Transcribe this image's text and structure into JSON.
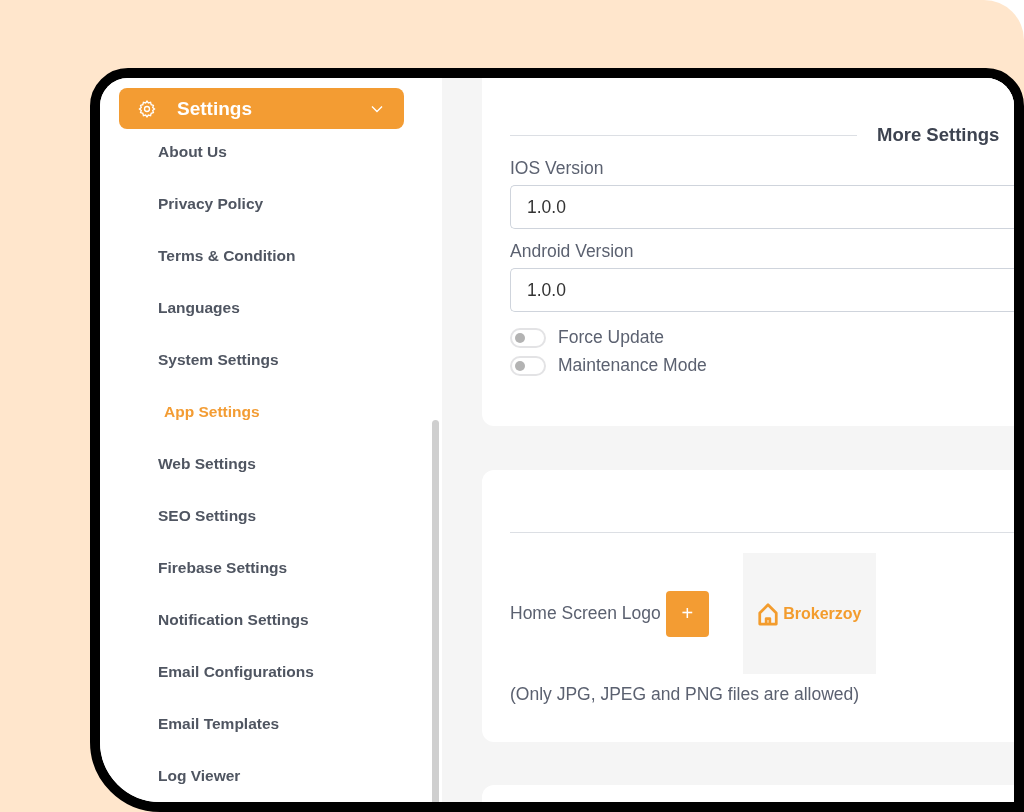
{
  "sidebar": {
    "group": {
      "label": "Settings",
      "expanded": true
    },
    "items": [
      {
        "label": "About Us",
        "selected": false
      },
      {
        "label": "Privacy Policy",
        "selected": false
      },
      {
        "label": "Terms & Condition",
        "selected": false
      },
      {
        "label": "Languages",
        "selected": false
      },
      {
        "label": "System Settings",
        "selected": false
      },
      {
        "label": "App Settings",
        "selected": true
      },
      {
        "label": "Web Settings",
        "selected": false
      },
      {
        "label": "SEO Settings",
        "selected": false
      },
      {
        "label": "Firebase Settings",
        "selected": false
      },
      {
        "label": "Notification Settings",
        "selected": false
      },
      {
        "label": "Email Configurations",
        "selected": false
      },
      {
        "label": "Email Templates",
        "selected": false
      },
      {
        "label": "Log Viewer",
        "selected": false
      }
    ]
  },
  "more_settings": {
    "title": "More Settings",
    "fields": [
      {
        "label": "IOS Version",
        "value": "1.0.0"
      },
      {
        "label": "Android Version",
        "value": "1.0.0"
      }
    ],
    "toggles": [
      {
        "label": "Force Update",
        "on": false
      },
      {
        "label": "Maintenance Mode",
        "on": false
      }
    ]
  },
  "logo_upload": {
    "label": "Home Screen Logo",
    "add_button": "+",
    "preview_text": "Brokerzoy",
    "note": "(Only JPG, JPEG and PNG files are allowed)"
  }
}
